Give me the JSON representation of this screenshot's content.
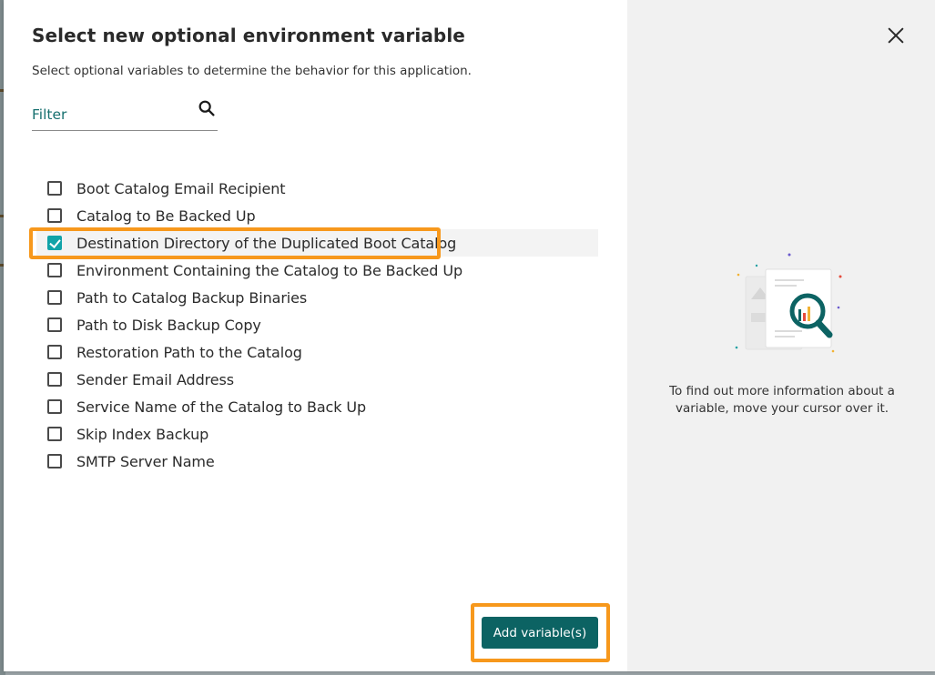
{
  "dialog": {
    "title": "Select new optional environment variable",
    "subtitle": "Select optional variables to determine the behavior for this application.",
    "filter": {
      "placeholder": "Filter",
      "value": ""
    },
    "variables": [
      {
        "label": "Boot Catalog Email Recipient",
        "checked": false
      },
      {
        "label": "Catalog to Be Backed Up",
        "checked": false
      },
      {
        "label": "Destination Directory of the Duplicated Boot Catalog",
        "checked": true
      },
      {
        "label": "Environment Containing the Catalog to Be Backed Up",
        "checked": false
      },
      {
        "label": "Path to Catalog Backup Binaries",
        "checked": false
      },
      {
        "label": "Path to Disk Backup Copy",
        "checked": false
      },
      {
        "label": "Restoration Path to the Catalog",
        "checked": false
      },
      {
        "label": "Sender Email Address",
        "checked": false
      },
      {
        "label": "Service Name of the Catalog to Back Up",
        "checked": false
      },
      {
        "label": "Skip Index Backup",
        "checked": false
      },
      {
        "label": "SMTP Server Name",
        "checked": false
      }
    ],
    "add_button_label": "Add variable(s)",
    "info_panel": {
      "text": "To find out more information about a variable, move your cursor over it.",
      "illustration_icon": "document-magnifier-icon"
    },
    "close_icon": "close-icon"
  },
  "colors": {
    "accent": "#0c6363",
    "checkbox_checked": "#11a3a8",
    "highlight": "#f7981c",
    "side_panel": "#f1f1f1"
  }
}
